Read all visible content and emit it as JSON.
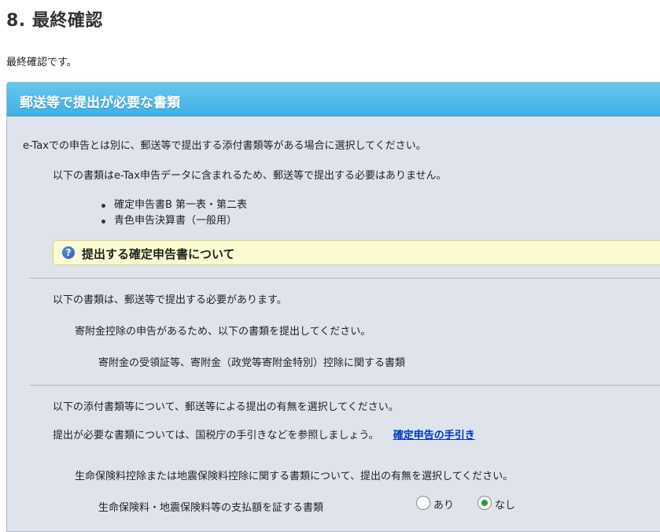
{
  "page": {
    "title": "8.  最終確認",
    "intro": "最終確認です。"
  },
  "panel": {
    "title": "郵送等で提出が必要な書類",
    "lead": "e-Taxでの申告とは別に、郵送等で提出する添付書類等がある場合に選択してください。",
    "included_note": "以下の書類はe-Tax申告データに含まれるため、郵送等で提出する必要はありません。",
    "included_docs": [
      "確定申告書B 第一表・第二表",
      "青色申告決算書（一般用）"
    ],
    "help_label": "提出する確定申告書について",
    "required_section": {
      "heading": "以下の書類は、郵送等で提出する必要があります。",
      "reason": "寄附金控除の申告があるため、以下の書類を提出してください。",
      "document": "寄附金の受領証等、寄附金（政党等寄附金特別）控除に関する書類"
    },
    "attachment_section": {
      "heading": "以下の添付書類等について、郵送等による提出の有無を選択してください。",
      "guide_text": "提出が必要な書類については、国税庁の手引きなどを参照しましょう。",
      "guide_link": "確定申告の手引き",
      "insurance_question": "生命保険料控除または地震保険料控除に関する書類について、提出の有無を選択してください。",
      "insurance_doc_label": "生命保険料・地震保険料等の支払額を証する書類",
      "options": {
        "yes": "あり",
        "no": "なし"
      },
      "selected": "なし"
    }
  }
}
